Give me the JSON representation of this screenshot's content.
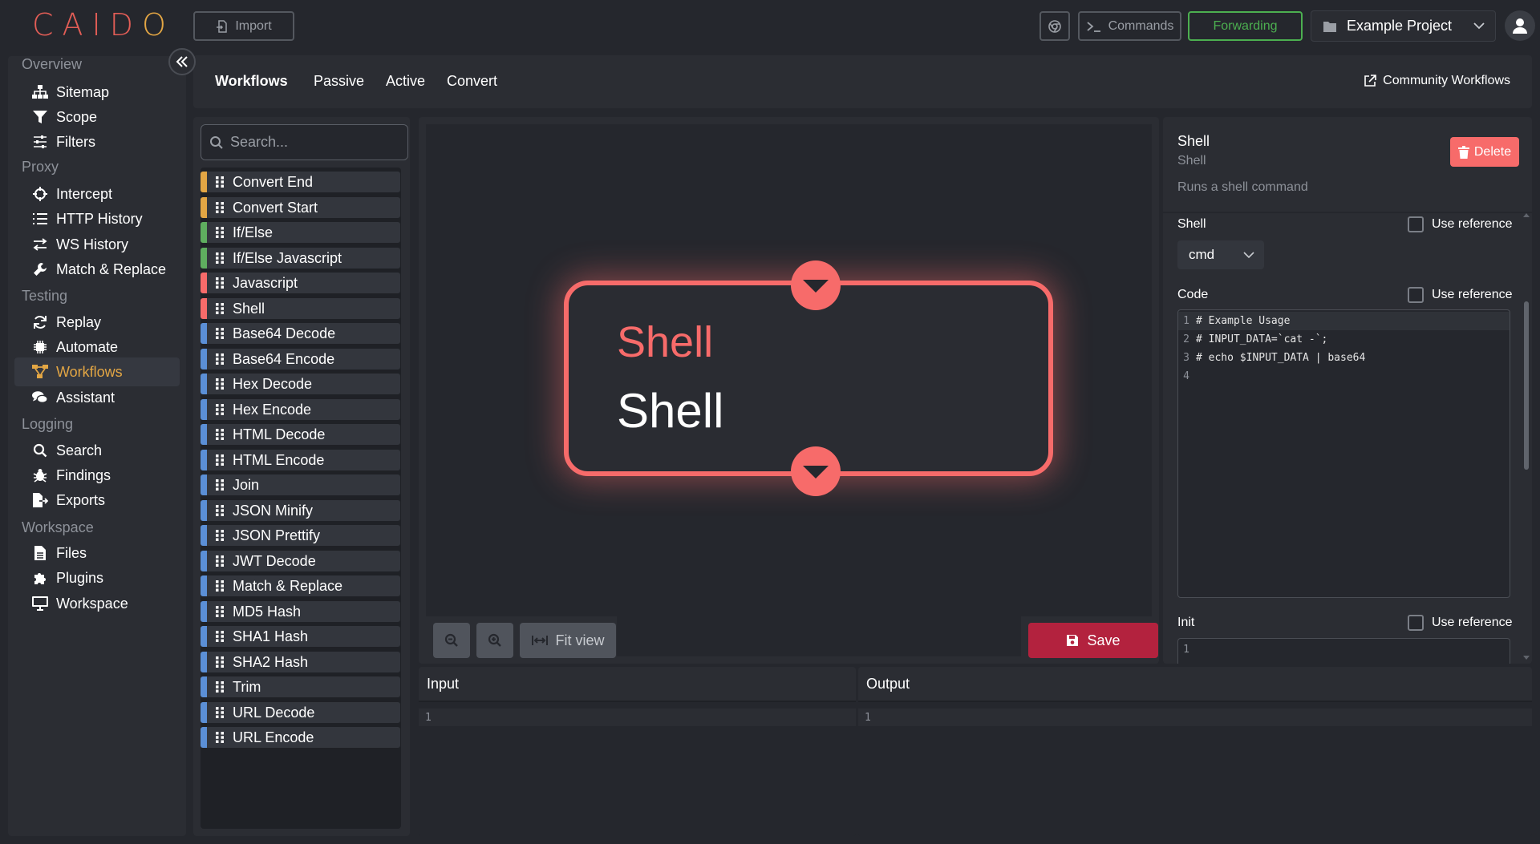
{
  "app": {
    "logo_text": "CAIDO",
    "brand_color": "#e25d56",
    "accent_color": "#e3a644"
  },
  "topbar": {
    "import_label": "Import",
    "commands_label": "Commands",
    "forwarding_label": "Forwarding",
    "project_name": "Example Project"
  },
  "sidebar": {
    "sections": [
      {
        "title": "Overview",
        "items": [
          {
            "label": "Sitemap",
            "icon": "sitemap-icon"
          },
          {
            "label": "Scope",
            "icon": "funnel-icon"
          },
          {
            "label": "Filters",
            "icon": "sliders-icon"
          }
        ]
      },
      {
        "title": "Proxy",
        "items": [
          {
            "label": "Intercept",
            "icon": "crosshair-icon"
          },
          {
            "label": "HTTP History",
            "icon": "list-icon"
          },
          {
            "label": "WS History",
            "icon": "arrows-icon"
          },
          {
            "label": "Match & Replace",
            "icon": "wrench-icon"
          }
        ]
      },
      {
        "title": "Testing",
        "items": [
          {
            "label": "Replay",
            "icon": "refresh-icon"
          },
          {
            "label": "Automate",
            "icon": "chip-icon"
          },
          {
            "label": "Workflows",
            "icon": "workflow-icon"
          },
          {
            "label": "Assistant",
            "icon": "chat-icon"
          }
        ]
      },
      {
        "title": "Logging",
        "items": [
          {
            "label": "Search",
            "icon": "search-icon"
          },
          {
            "label": "Findings",
            "icon": "bug-icon"
          },
          {
            "label": "Exports",
            "icon": "file-export-icon"
          }
        ]
      },
      {
        "title": "Workspace",
        "items": [
          {
            "label": "Files",
            "icon": "file-icon"
          },
          {
            "label": "Plugins",
            "icon": "puzzle-icon"
          },
          {
            "label": "Workspace",
            "icon": "monitor-icon"
          }
        ]
      }
    ],
    "active_item": "Workflows"
  },
  "tabs": {
    "items": [
      "Workflows",
      "Passive",
      "Active",
      "Convert"
    ],
    "active": "Workflows",
    "community_link": "Community Workflows"
  },
  "nodes": {
    "search_placeholder": "Search...",
    "items": [
      {
        "label": "Convert End",
        "color": "#e3a644"
      },
      {
        "label": "Convert Start",
        "color": "#e3a644"
      },
      {
        "label": "If/Else",
        "color": "#5fae5f"
      },
      {
        "label": "If/Else Javascript",
        "color": "#5fae5f"
      },
      {
        "label": "Javascript",
        "color": "#f76b6a"
      },
      {
        "label": "Shell",
        "color": "#f76b6a"
      },
      {
        "label": "Base64 Decode",
        "color": "#5b8fd6"
      },
      {
        "label": "Base64 Encode",
        "color": "#5b8fd6"
      },
      {
        "label": "Hex Decode",
        "color": "#5b8fd6"
      },
      {
        "label": "Hex Encode",
        "color": "#5b8fd6"
      },
      {
        "label": "HTML Decode",
        "color": "#5b8fd6"
      },
      {
        "label": "HTML Encode",
        "color": "#5b8fd6"
      },
      {
        "label": "Join",
        "color": "#5b8fd6"
      },
      {
        "label": "JSON Minify",
        "color": "#5b8fd6"
      },
      {
        "label": "JSON Prettify",
        "color": "#5b8fd6"
      },
      {
        "label": "JWT Decode",
        "color": "#5b8fd6"
      },
      {
        "label": "Match & Replace",
        "color": "#5b8fd6"
      },
      {
        "label": "MD5 Hash",
        "color": "#5b8fd6"
      },
      {
        "label": "SHA1 Hash",
        "color": "#5b8fd6"
      },
      {
        "label": "SHA2 Hash",
        "color": "#5b8fd6"
      },
      {
        "label": "Trim",
        "color": "#5b8fd6"
      },
      {
        "label": "URL Decode",
        "color": "#5b8fd6"
      },
      {
        "label": "URL Encode",
        "color": "#5b8fd6"
      }
    ]
  },
  "canvas": {
    "node_type": "Shell",
    "node_title": "Shell",
    "node_color": "#f76b6a",
    "fit_view_label": "Fit view",
    "save_label": "Save"
  },
  "properties": {
    "title": "Shell",
    "subtitle": "Shell",
    "description": "Runs a shell command",
    "delete_label": "Delete",
    "shell_label": "Shell",
    "shell_value": "cmd",
    "use_reference_label": "Use reference",
    "code_label": "Code",
    "code_lines": [
      {
        "num": "1",
        "text": "# Example Usage"
      },
      {
        "num": "2",
        "text": "# INPUT_DATA=`cat -`;"
      },
      {
        "num": "3",
        "text": "# echo $INPUT_DATA | base64"
      },
      {
        "num": "4",
        "text": ""
      }
    ],
    "init_label": "Init",
    "init_line": "1"
  },
  "io": {
    "input_label": "Input",
    "input_line": "1",
    "output_label": "Output",
    "output_line": "1"
  }
}
